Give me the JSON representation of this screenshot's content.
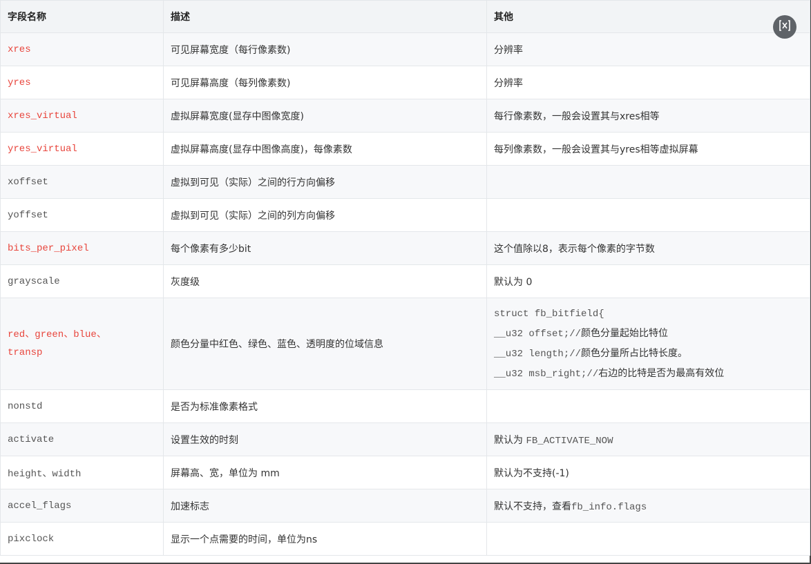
{
  "table": {
    "headers": [
      "字段名称",
      "描述",
      "其他"
    ],
    "rows": [
      {
        "field": "xres",
        "desc": "可见屏幕宽度（每行像素数)",
        "other": "分辨率"
      },
      {
        "field": "yres",
        "desc": "可见屏幕高度（每列像素数)",
        "other": "分辨率"
      },
      {
        "field": "xres_virtual",
        "desc": "虚拟屏幕宽度(显存中图像宽度)",
        "other": "每行像素数，一般会设置其与xres相等"
      },
      {
        "field": "yres_virtual",
        "desc": "虚拟屏幕高度(显存中图像高度)，每像素数",
        "other": "每列像素数，一般会设置其与yres相等虚拟屏幕"
      },
      {
        "field": "xoffset",
        "desc": "虚拟到可见（实际）之间的行方向偏移",
        "other": ""
      },
      {
        "field": "yoffset",
        "desc": "虚拟到可见（实际）之间的列方向偏移",
        "other": ""
      },
      {
        "field": "bits_per_pixel",
        "desc": "每个像素有多少bit",
        "other": "这个值除以8，表示每个像素的字节数"
      },
      {
        "field": "grayscale",
        "desc": "灰度级",
        "other": "默认为 0"
      },
      {
        "field_line1": "red、green、blue、",
        "field_line2": "transp",
        "desc": "颜色分量中红色、绿色、蓝色、透明度的位域信息",
        "other_lines": [
          {
            "code": "struct fb_bitfield{",
            "text": ""
          },
          {
            "code": "__u32 offset;//",
            "text": "颜色分量起始比特位"
          },
          {
            "code": "__u32 length;//",
            "text": "颜色分量所占比特长度。"
          },
          {
            "code": "__u32 msb_right;//",
            "text": "右边的比特是否为最高有效位"
          }
        ]
      },
      {
        "field": "nonstd",
        "desc": "是否为标准像素格式",
        "other": ""
      },
      {
        "field": "activate",
        "desc": "设置生效的时刻",
        "other_prefix": "默认为 ",
        "other_code": "FB_ACTIVATE_NOW"
      },
      {
        "field": "height、width",
        "desc": "屏幕高、宽，单位为 mm",
        "other": "默认为不支持(-1)"
      },
      {
        "field": "accel_flags",
        "desc": "加速标志",
        "other_prefix": "默认不支持，查看",
        "other_code": "fb_info.flags"
      },
      {
        "field": "pixclock",
        "desc": "显示一个点需要的时间，单位为ns",
        "other": ""
      }
    ]
  },
  "close_button": {
    "icon": "close-icon"
  },
  "colors": {
    "field_red": "#e8453c",
    "header_bg": "#f2f4f6",
    "row_alt_bg": "#f7f8fa",
    "border": "#e4e7ea"
  }
}
